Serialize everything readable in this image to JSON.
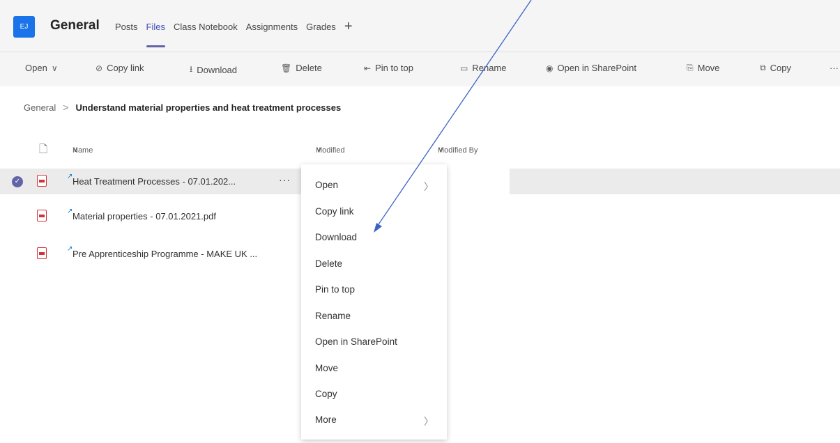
{
  "header": {
    "team_initials": "EJ",
    "channel_title": "General",
    "tabs": [
      {
        "label": "Posts",
        "active": false
      },
      {
        "label": "Files",
        "active": true
      },
      {
        "label": "Class Notebook",
        "active": false
      },
      {
        "label": "Assignments",
        "active": false
      },
      {
        "label": "Grades",
        "active": false
      }
    ],
    "add_tab": "+"
  },
  "toolbar": {
    "open": "Open",
    "copy_link": "Copy link",
    "download": "Download",
    "delete": "Delete",
    "pin_to_top": "Pin to top",
    "rename": "Rename",
    "open_in_sharepoint": "Open in SharePoint",
    "move": "Move",
    "copy": "Copy",
    "more": "···"
  },
  "breadcrumb": {
    "root": "General",
    "separator": ">",
    "current": "Understand material properties and heat treatment processes"
  },
  "columns": {
    "name": "Name",
    "modified": "Modified",
    "modified_by": "Modified By"
  },
  "files": [
    {
      "name": "Heat Treatment Processes - 07.01.202...",
      "selected": true
    },
    {
      "name": "Material properties - 07.01.2021.pdf",
      "selected": false
    },
    {
      "name": "Pre Apprenticeship Programme - MAKE UK ...",
      "selected": false
    }
  ],
  "row_more": "···",
  "context_menu": {
    "items": [
      {
        "label": "Open",
        "submenu": true
      },
      {
        "label": "Copy link",
        "submenu": false
      },
      {
        "label": "Download",
        "submenu": false
      },
      {
        "label": "Delete",
        "submenu": false
      },
      {
        "label": "Pin to top",
        "submenu": false
      },
      {
        "label": "Rename",
        "submenu": false
      },
      {
        "label": "Open in SharePoint",
        "submenu": false
      },
      {
        "label": "Move",
        "submenu": false
      },
      {
        "label": "Copy",
        "submenu": false
      },
      {
        "label": "More",
        "submenu": true
      }
    ]
  },
  "colors": {
    "accent": "#6264a7",
    "team_tile": "#1a73e8",
    "annotation_arrow": "#3b63c4",
    "pdf_red": "#d13438"
  }
}
